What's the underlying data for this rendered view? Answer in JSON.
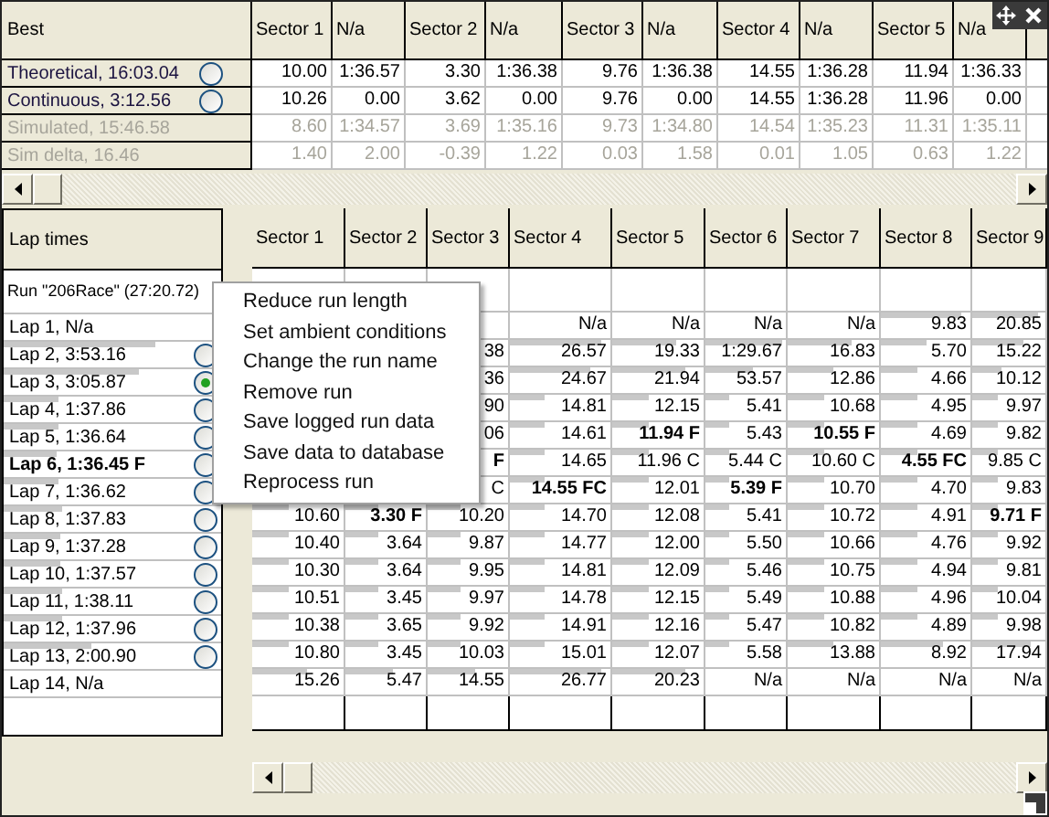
{
  "best_table": {
    "title": "Best",
    "columns": [
      "Sector 1",
      "N/a",
      "Sector 2",
      "N/a",
      "Sector 3",
      "N/a",
      "Sector 4",
      "N/a",
      "Sector 5",
      "N/a"
    ],
    "rows": [
      {
        "label": "Theoretical, 16:03.04",
        "disabled": false,
        "radio": {
          "selected": false
        },
        "cells": [
          "10.00",
          "1:36.57",
          "3.30",
          "1:36.38",
          "9.76",
          "1:36.38",
          "14.55",
          "1:36.28",
          "11.94",
          "1:36.33"
        ]
      },
      {
        "label": "Continuous, 3:12.56",
        "disabled": false,
        "radio": {
          "selected": false
        },
        "cells": [
          "10.26",
          "0.00",
          "3.62",
          "0.00",
          "9.76",
          "0.00",
          "14.55",
          "1:36.28",
          "11.96",
          "0.00"
        ]
      },
      {
        "label": "Simulated, 15:46.58",
        "disabled": true,
        "cells": [
          "8.60",
          "1:34.57",
          "3.69",
          "1:35.16",
          "9.73",
          "1:34.80",
          "14.54",
          "1:35.23",
          "11.31",
          "1:35.11"
        ]
      },
      {
        "label": "Sim delta, 16.46",
        "disabled": true,
        "cells": [
          "1.40",
          "2.00",
          "-0.39",
          "1.22",
          "0.03",
          "1.58",
          "0.01",
          "1.05",
          "0.63",
          "1.22"
        ]
      }
    ]
  },
  "lap_panel": {
    "title": "Lap times",
    "run": "Run \"206Race\" (27:20.72)",
    "laps": [
      {
        "label": "Lap 1, N/a",
        "bold": false
      },
      {
        "label": "Lap 2, 3:53.16",
        "bold": false,
        "level": 0.7,
        "radio": {
          "selected": false
        }
      },
      {
        "label": "Lap 3, 3:05.87",
        "bold": false,
        "level": 0.62,
        "radio": {
          "selected": true
        }
      },
      {
        "label": "Lap 4, 1:37.86",
        "bold": false,
        "level": 0.25,
        "radio": {
          "selected": false
        }
      },
      {
        "label": "Lap 5, 1:36.64",
        "bold": false,
        "level": 0.25,
        "radio": {
          "selected": false
        }
      },
      {
        "label": "Lap 6, 1:36.45 F",
        "bold": true,
        "level": 0.24,
        "radio": {
          "selected": false
        }
      },
      {
        "label": "Lap 7, 1:36.62",
        "bold": false,
        "level": 0.25,
        "radio": {
          "selected": false
        }
      },
      {
        "label": "Lap 8, 1:37.83",
        "bold": false,
        "level": 0.27,
        "radio": {
          "selected": false
        }
      },
      {
        "label": "Lap 9, 1:37.28",
        "bold": false,
        "level": 0.26,
        "radio": {
          "selected": false
        }
      },
      {
        "label": "Lap 10, 1:37.57",
        "bold": false,
        "level": 0.26,
        "radio": {
          "selected": false
        }
      },
      {
        "label": "Lap 11, 1:38.11",
        "bold": false,
        "level": 0.27,
        "radio": {
          "selected": false
        }
      },
      {
        "label": "Lap 12, 1:37.96",
        "bold": false,
        "level": 0.27,
        "radio": {
          "selected": false
        }
      },
      {
        "label": "Lap 13, 2:00.90",
        "bold": false,
        "level": 0.4,
        "radio": {
          "selected": false
        }
      },
      {
        "label": "Lap 14, N/a",
        "bold": false
      }
    ]
  },
  "sector_table": {
    "columns": [
      "Sector 1",
      "Sector 2",
      "Sector 3",
      "Sector 4",
      "Sector 5",
      "Sector 6",
      "Sector 7",
      "Sector 8",
      "Sector 9"
    ],
    "rows": [
      [
        {
          "text": ""
        },
        {
          "text": ""
        },
        {
          "text": ""
        },
        {
          "text": "N/a",
          "bold": false
        },
        {
          "text": "N/a",
          "bold": false
        },
        {
          "text": "N/a",
          "bold": false
        },
        {
          "text": "N/a",
          "bold": false
        },
        {
          "text": "9.83",
          "bold": false,
          "level": 0.9
        },
        {
          "text": "20.85",
          "bold": false,
          "level": 0.9
        }
      ],
      [
        {
          "text": ""
        },
        {
          "text": ""
        },
        {
          "text": "38",
          "bold": false
        },
        {
          "text": "26.57",
          "bold": false,
          "level": 0.9
        },
        {
          "text": "19.33",
          "bold": false,
          "level": 0.7
        },
        {
          "text": "1:29.67",
          "bold": false,
          "level": 0.95
        },
        {
          "text": "16.83",
          "bold": false,
          "level": 0.7
        },
        {
          "text": "5.70",
          "bold": false,
          "level": 0.5
        },
        {
          "text": "15.22",
          "bold": false,
          "level": 0.7
        }
      ],
      [
        {
          "text": ""
        },
        {
          "text": ""
        },
        {
          "text": "36",
          "bold": false
        },
        {
          "text": "24.67",
          "bold": false,
          "level": 0.8
        },
        {
          "text": "21.94",
          "bold": false,
          "level": 0.8
        },
        {
          "text": "53.57",
          "bold": false,
          "level": 0.6
        },
        {
          "text": "12.86",
          "bold": false,
          "level": 0.5
        },
        {
          "text": "4.66",
          "bold": false,
          "level": 0.4
        },
        {
          "text": "10.12",
          "bold": false,
          "level": 0.4
        }
      ],
      [
        {
          "text": ""
        },
        {
          "text": ""
        },
        {
          "text": "90",
          "bold": false
        },
        {
          "text": "14.81",
          "bold": false,
          "level": 0.35
        },
        {
          "text": "12.15",
          "bold": false,
          "level": 0.4
        },
        {
          "text": "5.41",
          "bold": false,
          "level": 0.3
        },
        {
          "text": "10.68",
          "bold": false,
          "level": 0.4
        },
        {
          "text": "4.95",
          "bold": false,
          "level": 0.4
        },
        {
          "text": "9.97",
          "bold": false,
          "level": 0.35
        }
      ],
      [
        {
          "text": ""
        },
        {
          "text": ""
        },
        {
          "text": "06",
          "bold": false
        },
        {
          "text": "14.61",
          "bold": false,
          "level": 0.35
        },
        {
          "text": "11.94 F",
          "bold": true,
          "level": 0.4
        },
        {
          "text": "5.43",
          "bold": false,
          "level": 0.3
        },
        {
          "text": "10.55 F",
          "bold": true,
          "level": 0.4
        },
        {
          "text": "4.69",
          "bold": false,
          "level": 0.4
        },
        {
          "text": "9.82",
          "bold": false,
          "level": 0.35
        }
      ],
      [
        {
          "text": ""
        },
        {
          "text": ""
        },
        {
          "text": "F",
          "bold": true
        },
        {
          "text": "14.65",
          "bold": false,
          "level": 0.35
        },
        {
          "text": "11.96 C",
          "bold": false,
          "level": 0.4
        },
        {
          "text": "5.44 C",
          "bold": false,
          "level": 0.3
        },
        {
          "text": "10.60 C",
          "bold": false,
          "level": 0.4
        },
        {
          "text": "4.55 FC",
          "bold": true,
          "level": 0.4
        },
        {
          "text": "9.85 C",
          "bold": false,
          "level": 0.35
        }
      ],
      [
        {
          "text": ""
        },
        {
          "text": ""
        },
        {
          "text": "C",
          "bold": false
        },
        {
          "text": "14.55 FC",
          "bold": true,
          "level": 0.35
        },
        {
          "text": "12.01",
          "bold": false,
          "level": 0.4
        },
        {
          "text": "5.39 F",
          "bold": true,
          "level": 0.3
        },
        {
          "text": "10.70",
          "bold": false,
          "level": 0.4
        },
        {
          "text": "4.70",
          "bold": false,
          "level": 0.4
        },
        {
          "text": "9.83",
          "bold": false,
          "level": 0.35
        }
      ],
      [
        {
          "text": "10.60",
          "bold": false,
          "level": 0.4
        },
        {
          "text": "3.30 F",
          "bold": true,
          "level": 0.4
        },
        {
          "text": "10.20",
          "bold": false,
          "level": 0.4
        },
        {
          "text": "14.70",
          "bold": false,
          "level": 0.35
        },
        {
          "text": "12.08",
          "bold": false,
          "level": 0.4
        },
        {
          "text": "5.41",
          "bold": false,
          "level": 0.3
        },
        {
          "text": "10.72",
          "bold": false,
          "level": 0.4
        },
        {
          "text": "4.91",
          "bold": false,
          "level": 0.4
        },
        {
          "text": "9.71 F",
          "bold": true,
          "level": 0.35
        }
      ],
      [
        {
          "text": "10.40",
          "bold": false,
          "level": 0.4
        },
        {
          "text": "3.64",
          "bold": false,
          "level": 0.4
        },
        {
          "text": "9.87",
          "bold": false,
          "level": 0.4
        },
        {
          "text": "14.77",
          "bold": false,
          "level": 0.35
        },
        {
          "text": "12.00",
          "bold": false,
          "level": 0.4
        },
        {
          "text": "5.50",
          "bold": false,
          "level": 0.3
        },
        {
          "text": "10.66",
          "bold": false,
          "level": 0.4
        },
        {
          "text": "4.76",
          "bold": false,
          "level": 0.4
        },
        {
          "text": "9.92",
          "bold": false,
          "level": 0.35
        }
      ],
      [
        {
          "text": "10.30",
          "bold": false,
          "level": 0.4
        },
        {
          "text": "3.64",
          "bold": false,
          "level": 0.4
        },
        {
          "text": "9.95",
          "bold": false,
          "level": 0.4
        },
        {
          "text": "14.81",
          "bold": false,
          "level": 0.35
        },
        {
          "text": "12.09",
          "bold": false,
          "level": 0.4
        },
        {
          "text": "5.46",
          "bold": false,
          "level": 0.3
        },
        {
          "text": "10.75",
          "bold": false,
          "level": 0.4
        },
        {
          "text": "4.94",
          "bold": false,
          "level": 0.4
        },
        {
          "text": "9.81",
          "bold": false,
          "level": 0.35
        }
      ],
      [
        {
          "text": "10.51",
          "bold": false,
          "level": 0.4
        },
        {
          "text": "3.45",
          "bold": false,
          "level": 0.4
        },
        {
          "text": "9.97",
          "bold": false,
          "level": 0.4
        },
        {
          "text": "14.78",
          "bold": false,
          "level": 0.35
        },
        {
          "text": "12.15",
          "bold": false,
          "level": 0.4
        },
        {
          "text": "5.49",
          "bold": false,
          "level": 0.3
        },
        {
          "text": "10.88",
          "bold": false,
          "level": 0.4
        },
        {
          "text": "4.96",
          "bold": false,
          "level": 0.4
        },
        {
          "text": "10.04",
          "bold": false,
          "level": 0.35
        }
      ],
      [
        {
          "text": "10.38",
          "bold": false,
          "level": 0.4
        },
        {
          "text": "3.65",
          "bold": false,
          "level": 0.4
        },
        {
          "text": "9.92",
          "bold": false,
          "level": 0.4
        },
        {
          "text": "14.91",
          "bold": false,
          "level": 0.35
        },
        {
          "text": "12.16",
          "bold": false,
          "level": 0.4
        },
        {
          "text": "5.47",
          "bold": false,
          "level": 0.3
        },
        {
          "text": "10.82",
          "bold": false,
          "level": 0.4
        },
        {
          "text": "4.89",
          "bold": false,
          "level": 0.4
        },
        {
          "text": "9.98",
          "bold": false,
          "level": 0.35
        }
      ],
      [
        {
          "text": "10.80",
          "bold": false,
          "level": 0.4
        },
        {
          "text": "3.45",
          "bold": false,
          "level": 0.4
        },
        {
          "text": "10.03",
          "bold": false,
          "level": 0.4
        },
        {
          "text": "15.01",
          "bold": false,
          "level": 0.35
        },
        {
          "text": "12.07",
          "bold": false,
          "level": 0.4
        },
        {
          "text": "5.58",
          "bold": false,
          "level": 0.3
        },
        {
          "text": "13.88",
          "bold": false,
          "level": 0.5
        },
        {
          "text": "8.92",
          "bold": false,
          "level": 0.7
        },
        {
          "text": "17.94",
          "bold": false,
          "level": 0.8
        }
      ],
      [
        {
          "text": "15.26",
          "bold": false,
          "level": 0.6
        },
        {
          "text": "5.47",
          "bold": false,
          "level": 0.6
        },
        {
          "text": "14.55",
          "bold": false,
          "level": 0.6
        },
        {
          "text": "26.77",
          "bold": false,
          "level": 0.9
        },
        {
          "text": "20.23",
          "bold": false,
          "level": 0.8
        },
        {
          "text": "N/a",
          "bold": false
        },
        {
          "text": "N/a",
          "bold": false
        },
        {
          "text": "N/a",
          "bold": false
        },
        {
          "text": "N/a",
          "bold": false
        }
      ]
    ]
  },
  "context_menu": [
    "Reduce run length",
    "Set ambient conditions",
    "Change the run name",
    "Remove run",
    "Save logged run data",
    "Save data to database",
    "Reprocess run"
  ]
}
